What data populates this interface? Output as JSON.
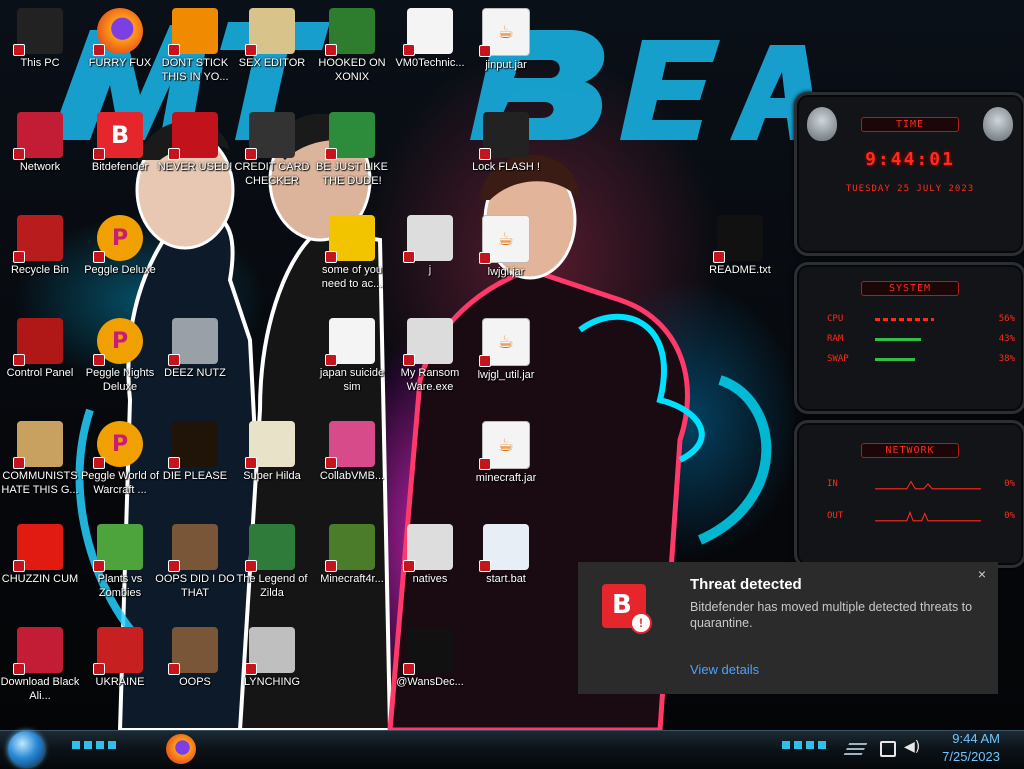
{
  "desktop": {
    "icons": [
      {
        "label": "This PC",
        "icon": "computer-icon",
        "color": "#222222"
      },
      {
        "label": "FURRY FUX",
        "icon": "firefox-icon",
        "color": "#ff7a1a"
      },
      {
        "label": "DONT STICK THIS IN YO...",
        "icon": "vlc-cone-icon",
        "color": "#f08a00"
      },
      {
        "label": "SEX EDITOR",
        "icon": "hxd-editor-icon",
        "color": "#d8c48a"
      },
      {
        "label": "HOOKED ON XONIX",
        "icon": "xonix-game-icon",
        "color": "#2e7d2e"
      },
      {
        "label": "VM0Technic...",
        "icon": "doctor-icon",
        "color": "#f4f4f4"
      },
      {
        "label": "jinput.jar",
        "icon": "java-jar-icon",
        "color": "#f4f4f4"
      },
      {
        "label": "Network",
        "icon": "network-icon",
        "color": "#c21d35"
      },
      {
        "label": "Bitdefender",
        "icon": "bitdefender-icon",
        "color": "#e5262d"
      },
      {
        "label": "NEVER USED!",
        "icon": "devcpp-icon",
        "color": "#c2121b"
      },
      {
        "label": "CREDIT CARD CHECKER",
        "icon": "credit-card-icon",
        "color": "#333333"
      },
      {
        "label": "BE JUST LIKE THE DUDE!",
        "icon": "dude-icon",
        "color": "#2c8c3c"
      },
      {
        "label": "Lock FLASH !",
        "icon": "lock-flash-icon",
        "color": "#222222"
      },
      {
        "label": "Recycle Bin",
        "icon": "recycle-bin-icon",
        "color": "#b91c1c"
      },
      {
        "label": "Peggle Deluxe",
        "icon": "peggle-icon",
        "color": "#f0a000"
      },
      {
        "label": "some of you need to ac...",
        "icon": "beaver-icon",
        "color": "#f2c400"
      },
      {
        "label": "j",
        "icon": "file-icon",
        "color": "#dddddd"
      },
      {
        "label": "lwjgl.jar",
        "icon": "java-jar-icon",
        "color": "#f4f4f4"
      },
      {
        "label": "README.txt",
        "icon": "text-file-icon",
        "color": "#111111"
      },
      {
        "label": "Control Panel",
        "icon": "control-panel-icon",
        "color": "#b01818"
      },
      {
        "label": "Peggle Nights Deluxe",
        "icon": "peggle-icon",
        "color": "#f0a000"
      },
      {
        "label": "DEEZ NUTZ",
        "icon": "folder-stack-icon",
        "color": "#9aa0a8"
      },
      {
        "label": "japan suicide sim",
        "icon": "document-icon",
        "color": "#f4f4f4"
      },
      {
        "label": "My Ransom Ware.exe",
        "icon": "app-window-icon",
        "color": "#dcdcdc"
      },
      {
        "label": "lwjgl_util.jar",
        "icon": "java-jar-icon",
        "color": "#f4f4f4"
      },
      {
        "label": "COMMUNISTS HATE THIS G...",
        "icon": "money-bag-icon",
        "color": "#c8a060"
      },
      {
        "label": "Peggle World of Warcraft ...",
        "icon": "peggle-icon",
        "color": "#f0a000"
      },
      {
        "label": "DIE PLEASE",
        "icon": "after-effects-icon",
        "color": "#1f1407"
      },
      {
        "label": "Super Hilda",
        "icon": "pixel-game-icon",
        "color": "#e8e2c8"
      },
      {
        "label": "CollabVMB...",
        "icon": "monitor-icon",
        "color": "#d84b8a"
      },
      {
        "label": "minecraft.jar",
        "icon": "java-jar-icon",
        "color": "#f4f4f4"
      },
      {
        "label": "CHUZZIN CUM",
        "icon": "chuzzle-icon",
        "color": "#e21b12"
      },
      {
        "label": "Plants vs Zombies",
        "icon": "plant-icon",
        "color": "#4da43c"
      },
      {
        "label": "OOPS DID I DO THAT",
        "icon": "portrait-icon",
        "color": "#7a5638"
      },
      {
        "label": "The Legend of Zilda",
        "icon": "zilda-icon",
        "color": "#2f7c3a"
      },
      {
        "label": "Minecraft4r...",
        "icon": "grass-block-icon",
        "color": "#4b7c2a"
      },
      {
        "label": "natives",
        "icon": "file-icon",
        "color": "#dddddd"
      },
      {
        "label": "start.bat",
        "icon": "batch-gear-icon",
        "color": "#e8eef5"
      },
      {
        "label": "Download Black Ali...",
        "icon": "alien-icon",
        "color": "#c21d35"
      },
      {
        "label": "UKRAINE",
        "icon": "radiation-icon",
        "color": "#c62020"
      },
      {
        "label": "OOPS",
        "icon": "portrait-icon",
        "color": "#7a5638"
      },
      {
        "label": "LYNCHING",
        "icon": "knot-icon",
        "color": "#bfbfbf"
      },
      {
        "label": "@WansDec...",
        "icon": "dark-image-icon",
        "color": "#111111"
      }
    ]
  },
  "widgets": {
    "time": {
      "title": "TIME",
      "clock": "9:44:01",
      "date": "TUESDAY 25 JULY 2023"
    },
    "system": {
      "title": "SYSTEM",
      "rows": [
        {
          "label": "CPU",
          "pct": "56%",
          "value": 0.56
        },
        {
          "label": "RAM",
          "pct": "43%",
          "value": 0.43
        },
        {
          "label": "SWAP",
          "pct": "38%",
          "value": 0.38
        }
      ]
    },
    "network": {
      "title": "NETWORK",
      "rows": [
        {
          "label": "IN",
          "pct": "0%"
        },
        {
          "label": "OUT",
          "pct": "0%"
        }
      ]
    },
    "accent": "#ff2a1a"
  },
  "toast": {
    "title": "Threat detected",
    "body": "Bitdefender has moved multiple detected threats to quarantine.",
    "action": "View details",
    "close": "×",
    "link_color": "#4aa3ff"
  },
  "taskbar": {
    "time": "9:44 AM",
    "date": "7/25/2023",
    "clock_color": "#6fc4ff"
  }
}
